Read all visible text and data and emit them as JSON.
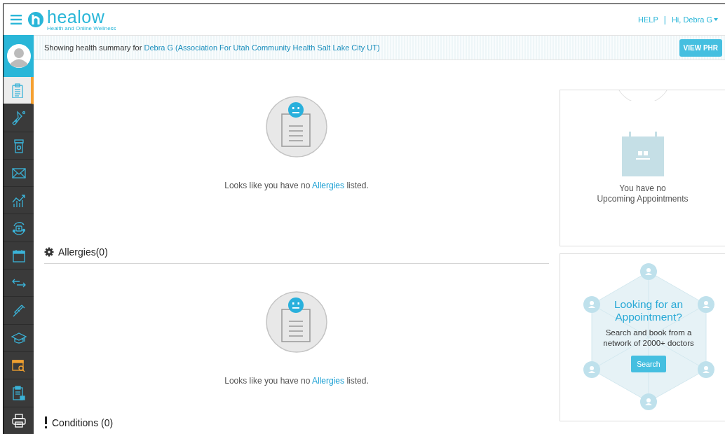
{
  "header": {
    "logo": {
      "name": "healow",
      "tagline": "Health and Online Wellness"
    },
    "help": "HELP",
    "separator": "|",
    "user": "Hi, Debra G"
  },
  "banner": {
    "prefix": "Showing health summary for",
    "patient": "Debra G (Association For Utah Community Health Salt Lake City UT)",
    "button": "VIEW PHR"
  },
  "sidebar": {
    "items": [
      {
        "selected": true
      },
      {
        "selected": false
      },
      {
        "selected": false
      },
      {
        "selected": false
      },
      {
        "selected": false
      },
      {
        "selected": false
      },
      {
        "selected": false
      },
      {
        "selected": false
      },
      {
        "selected": false
      },
      {
        "selected": false
      },
      {
        "selected": false
      },
      {
        "selected": false
      },
      {
        "selected": false
      }
    ]
  },
  "main": {
    "blocks": [
      {
        "kind": "empty",
        "before": "Looks like you have no",
        "link": "Allergies",
        "after": "listed."
      },
      {
        "kind": "heading",
        "title": "Allergies(0)"
      },
      {
        "kind": "empty",
        "before": "Looks like you have no",
        "link": "Allergies",
        "after": "listed."
      },
      {
        "kind": "heading",
        "title": "Conditions (0)"
      }
    ]
  },
  "appointments": {
    "lines": [
      "You have no",
      "Upcoming Appointments"
    ]
  },
  "finder": {
    "title": "Looking for an Appointment?",
    "text": "Search and book from a network of 2000+ doctors",
    "button": "Search"
  }
}
